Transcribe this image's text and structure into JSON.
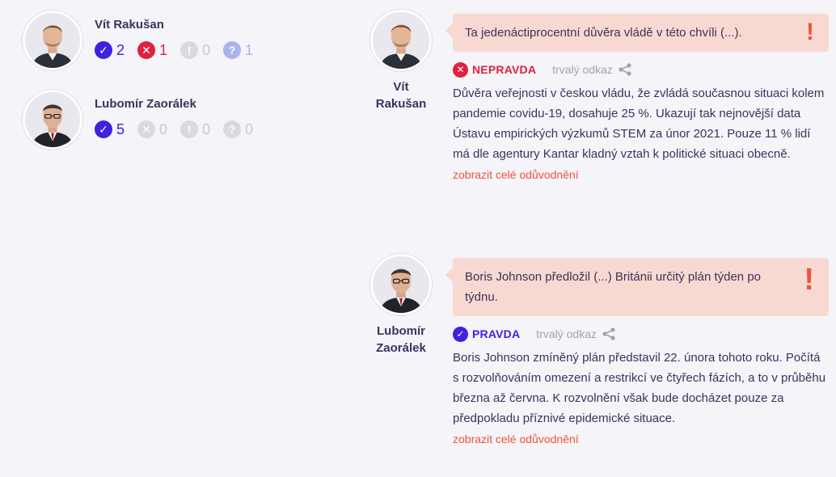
{
  "speakers": [
    {
      "name": "Vít Rakušan",
      "avatar_icon": "portrait-young-man",
      "counts": {
        "true": "2",
        "false": "1",
        "misleading": "0",
        "unverifiable": "1"
      }
    },
    {
      "name": "Lubomír Zaorálek",
      "avatar_icon": "portrait-man-glasses",
      "counts": {
        "true": "5",
        "false": "0",
        "misleading": "0",
        "unverifiable": "0"
      }
    }
  ],
  "icons": {
    "true": "✓",
    "false": "✕",
    "misleading": "!",
    "unverifiable": "?",
    "quote_alert": "!"
  },
  "statements": [
    {
      "speaker_name": "Vít Rakušan",
      "quote": "Ta jedenáctiprocentní důvěra vládě v této chvíli (...).",
      "verdict": "NEPRAVDA",
      "permalink": "trvalý odkaz",
      "explanation": "Důvěra veřejnosti v českou vládu, že zvládá současnou situaci kolem pandemie covidu-19, dosahuje 25 %. Ukazují tak nejnovější data Ústavu empirických výzkumů STEM za únor 2021. Pouze 11 % lidí má dle agentury Kantar kladný vztah k politické situaci obecně.",
      "more": "zobrazit celé odůvodnění"
    },
    {
      "speaker_name": "Lubomír Zaorálek",
      "quote": "Boris Johnson předložil (...) Británii určitý plán týden po týdnu.",
      "verdict": "PRAVDA",
      "permalink": "trvalý odkaz",
      "explanation": "Boris Johnson zmíněný plán představil 22. února tohoto roku. Počítá s rozvolňováním omezení a restrikcí ve čtyřech fázích, a to v průběhu března až června. K rozvolnění však bude docházet pouze za předpokladu příznivé epidemické situace.",
      "more": "zobrazit celé odůvodnění"
    }
  ],
  "colors": {
    "background": "#f4f4f9",
    "true": "#3d22e0",
    "false": "#e0203c",
    "neutral": "#d9d9de",
    "unverifiable": "#a9b3ec",
    "quote_bg": "#f8d9d1",
    "accent": "#f0533a",
    "text": "#3c325c"
  }
}
